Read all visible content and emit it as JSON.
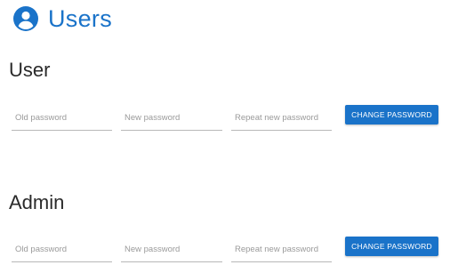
{
  "header": {
    "title": "Users",
    "icon": "account-circle-icon",
    "accent_color": "#1a73c9"
  },
  "sections": [
    {
      "title": "User",
      "old_password_placeholder": "Old password",
      "new_password_placeholder": "New password",
      "repeat_password_placeholder": "Repeat new password",
      "button_label": "CHANGE PASSWORD"
    },
    {
      "title": "Admin",
      "old_password_placeholder": "Old password",
      "new_password_placeholder": "New password",
      "repeat_password_placeholder": "Repeat new password",
      "button_label": "CHANGE PASSWORD"
    }
  ]
}
